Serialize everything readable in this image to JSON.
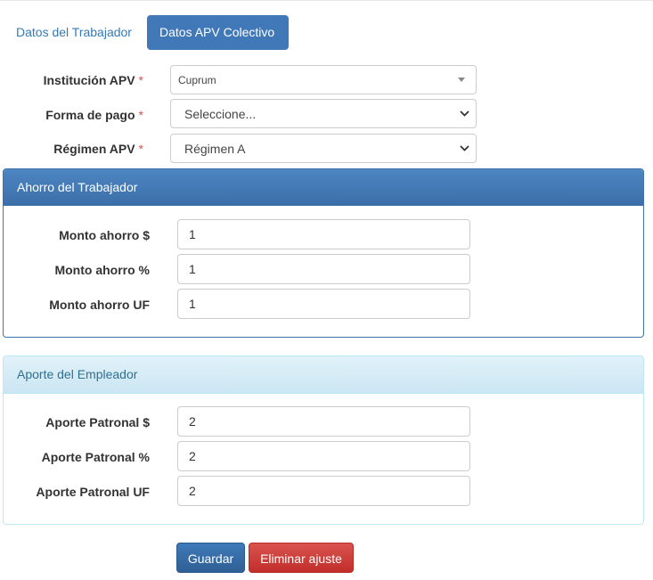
{
  "tabs": {
    "worker": "Datos del Trabajador",
    "apv_collective": "Datos APV Colectivo"
  },
  "form": {
    "institution": {
      "label": "Institución APV",
      "required_mark": "*",
      "value": "Cuprum"
    },
    "payment": {
      "label": "Forma de pago",
      "required_mark": "*",
      "value": "Seleccione..."
    },
    "regime": {
      "label": "Régimen APV",
      "required_mark": "*",
      "value": "Régimen A"
    }
  },
  "worker_savings": {
    "title": "Ahorro del Trabajador",
    "fields": [
      {
        "label": "Monto ahorro $",
        "value": "1"
      },
      {
        "label": "Monto ahorro %",
        "value": "1"
      },
      {
        "label": "Monto ahorro UF",
        "value": "1"
      }
    ]
  },
  "employer_contribution": {
    "title": "Aporte del Empleador",
    "fields": [
      {
        "label": "Aporte Patronal $",
        "value": "2"
      },
      {
        "label": "Aporte Patronal %",
        "value": "2"
      },
      {
        "label": "Aporte Patronal UF",
        "value": "2"
      }
    ]
  },
  "actions": {
    "save": "Guardar",
    "delete": "Eliminar ajuste"
  },
  "colors": {
    "primary": "#4078b8",
    "danger": "#d9534f",
    "info_header": "#d9edf7",
    "required": "#d9534f"
  }
}
